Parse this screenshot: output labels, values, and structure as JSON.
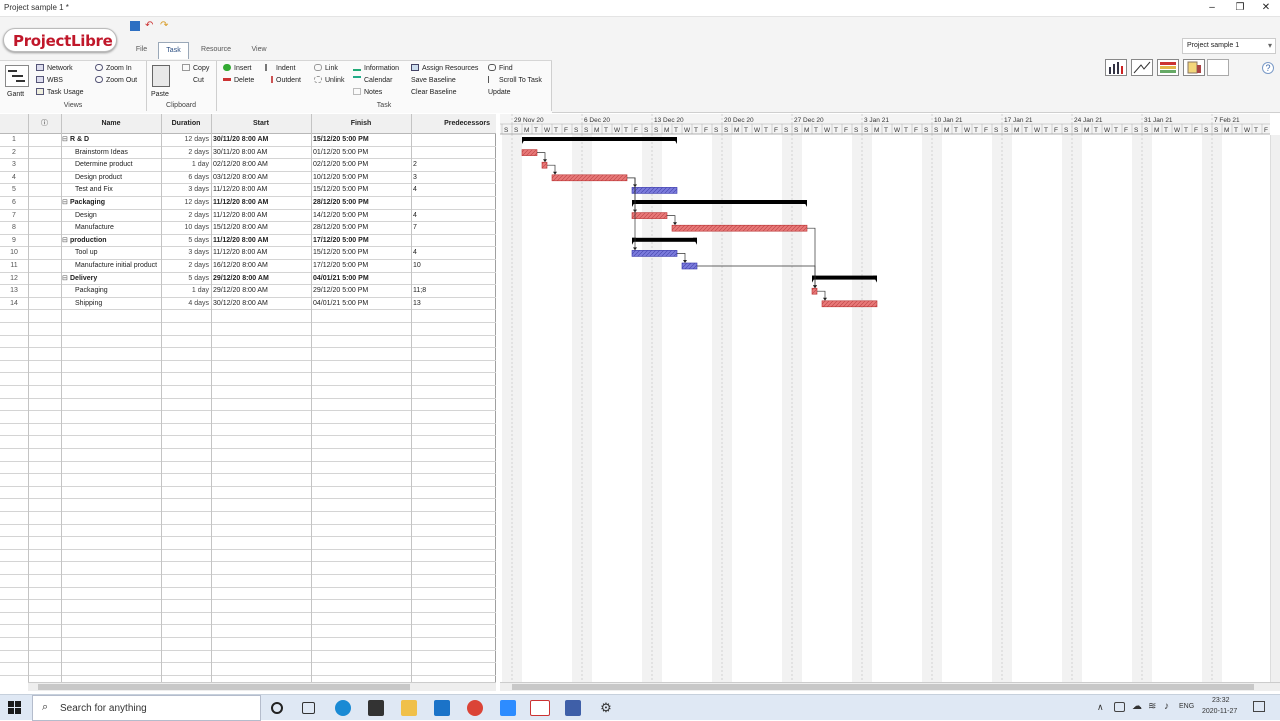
{
  "window": {
    "title": "Project sample 1 *",
    "minimize": "–",
    "maximize": "❐",
    "close": "✕"
  },
  "app": {
    "logo_text": "ProjectLibre",
    "project_selector": "Project sample 1"
  },
  "menu_tabs": [
    {
      "label": "File"
    },
    {
      "label": "Task"
    },
    {
      "label": "Resource"
    },
    {
      "label": "View"
    }
  ],
  "ribbon": {
    "views": {
      "group_label": "Views",
      "gantt": "Gantt",
      "network": "Network",
      "wbs": "WBS",
      "task_usage": "Task Usage",
      "zoom_in": "Zoom In",
      "zoom_out": "Zoom Out"
    },
    "clipboard": {
      "group_label": "Clipboard",
      "paste": "Paste",
      "copy": "Copy",
      "cut": "Cut"
    },
    "task": {
      "group_label": "Task",
      "insert": "Insert",
      "delete": "Delete",
      "indent": "Indent",
      "outdent": "Outdent",
      "link": "Link",
      "unlink": "Unlink",
      "information": "Information",
      "calendar": "Calendar",
      "notes": "Notes",
      "assign_resources": "Assign Resources",
      "save_baseline": "Save Baseline",
      "clear_baseline": "Clear Baseline",
      "find": "Find",
      "scroll_to_task": "Scroll To Task",
      "update": "Update"
    }
  },
  "table": {
    "headers": {
      "info": "ⓘ",
      "name": "Name",
      "duration": "Duration",
      "start": "Start",
      "finish": "Finish",
      "predecessors": "Predecessors"
    },
    "rows": [
      {
        "id": "1",
        "name": "R & D",
        "duration": "12 days",
        "start": "30/11/20 8:00 AM",
        "finish": "15/12/20 5:00 PM",
        "pred": "",
        "summary": true
      },
      {
        "id": "2",
        "name": "Brainstorm Ideas",
        "duration": "2 days",
        "start": "30/11/20 8:00 AM",
        "finish": "01/12/20 5:00 PM",
        "pred": "",
        "summary": false
      },
      {
        "id": "3",
        "name": "Determine product",
        "duration": "1 day",
        "start": "02/12/20 8:00 AM",
        "finish": "02/12/20 5:00 PM",
        "pred": "2",
        "summary": false
      },
      {
        "id": "4",
        "name": "Design product",
        "duration": "6 days",
        "start": "03/12/20 8:00 AM",
        "finish": "10/12/20 5:00 PM",
        "pred": "3",
        "summary": false
      },
      {
        "id": "5",
        "name": "Test and Fix",
        "duration": "3 days",
        "start": "11/12/20 8:00 AM",
        "finish": "15/12/20 5:00 PM",
        "pred": "4",
        "summary": false
      },
      {
        "id": "6",
        "name": "Packaging",
        "duration": "12 days",
        "start": "11/12/20 8:00 AM",
        "finish": "28/12/20 5:00 PM",
        "pred": "",
        "summary": true
      },
      {
        "id": "7",
        "name": "Design",
        "duration": "2 days",
        "start": "11/12/20 8:00 AM",
        "finish": "14/12/20 5:00 PM",
        "pred": "4",
        "summary": false
      },
      {
        "id": "8",
        "name": "Manufacture",
        "duration": "10 days",
        "start": "15/12/20 8:00 AM",
        "finish": "28/12/20 5:00 PM",
        "pred": "7",
        "summary": false
      },
      {
        "id": "9",
        "name": "production",
        "duration": "5 days",
        "start": "11/12/20 8:00 AM",
        "finish": "17/12/20 5:00 PM",
        "pred": "",
        "summary": true
      },
      {
        "id": "10",
        "name": "Tool up",
        "duration": "3 days",
        "start": "11/12/20 8:00 AM",
        "finish": "15/12/20 5:00 PM",
        "pred": "4",
        "summary": false
      },
      {
        "id": "11",
        "name": "Manufacture initial product",
        "duration": "2 days",
        "start": "16/12/20 8:00 AM",
        "finish": "17/12/20 5:00 PM",
        "pred": "10",
        "summary": false
      },
      {
        "id": "12",
        "name": "Delivery",
        "duration": "5 days",
        "start": "29/12/20 8:00 AM",
        "finish": "04/01/21 5:00 PM",
        "pred": "",
        "summary": true
      },
      {
        "id": "13",
        "name": "Packaging",
        "duration": "1 day",
        "start": "29/12/20 8:00 AM",
        "finish": "29/12/20 5:00 PM",
        "pred": "11;8",
        "summary": false
      },
      {
        "id": "14",
        "name": "Shipping",
        "duration": "4 days",
        "start": "30/12/20 8:00 AM",
        "finish": "04/01/21 5:00 PM",
        "pred": "13",
        "summary": false
      }
    ]
  },
  "gantt": {
    "timeline_start": "2020-11-28",
    "week_labels": [
      "29 Nov 20",
      "6 Dec 20",
      "13 Dec 20",
      "20 Dec 20",
      "27 Dec 20",
      "3 Jan 21",
      "10 Jan 21",
      "17 Jan 21",
      "24 Jan 21",
      "31 Jan 21",
      "7 Feb 21"
    ],
    "day_letters": [
      "S",
      "S",
      "M",
      "T",
      "W",
      "T",
      "F"
    ],
    "colors": {
      "critical": "#e87878",
      "normal": "#7b7bdc",
      "summary": "#000000"
    },
    "bars": [
      {
        "row": 1,
        "type": "summary",
        "start": "2020-11-30",
        "finish": "2020-12-15"
      },
      {
        "row": 2,
        "type": "critical",
        "start": "2020-11-30",
        "finish": "2020-12-01"
      },
      {
        "row": 3,
        "type": "critical",
        "start": "2020-12-02",
        "finish": "2020-12-02"
      },
      {
        "row": 4,
        "type": "critical",
        "start": "2020-12-03",
        "finish": "2020-12-10"
      },
      {
        "row": 5,
        "type": "normal",
        "start": "2020-12-11",
        "finish": "2020-12-15"
      },
      {
        "row": 6,
        "type": "summary",
        "start": "2020-12-11",
        "finish": "2020-12-28"
      },
      {
        "row": 7,
        "type": "critical",
        "start": "2020-12-11",
        "finish": "2020-12-14"
      },
      {
        "row": 8,
        "type": "critical",
        "start": "2020-12-15",
        "finish": "2020-12-28"
      },
      {
        "row": 9,
        "type": "summary",
        "start": "2020-12-11",
        "finish": "2020-12-17"
      },
      {
        "row": 10,
        "type": "normal",
        "start": "2020-12-11",
        "finish": "2020-12-15"
      },
      {
        "row": 11,
        "type": "normal",
        "start": "2020-12-16",
        "finish": "2020-12-17"
      },
      {
        "row": 12,
        "type": "summary",
        "start": "2020-12-29",
        "finish": "2021-01-04"
      },
      {
        "row": 13,
        "type": "critical",
        "start": "2020-12-29",
        "finish": "2020-12-29"
      },
      {
        "row": 14,
        "type": "critical",
        "start": "2020-12-30",
        "finish": "2021-01-04"
      }
    ]
  },
  "taskbar": {
    "search_placeholder": "Search for anything",
    "lang": "ENG",
    "time": "23:32",
    "date": "2020-11-27"
  }
}
